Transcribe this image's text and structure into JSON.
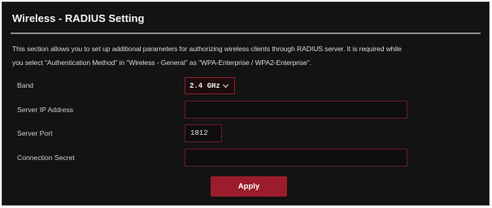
{
  "page": {
    "title": "Wireless - RADIUS Setting",
    "description_line1": "This section allows you to set up additional parameters for authorizing wireless clients through RADIUS server. It is required while",
    "description_line2": "you select \"Authentication Method\" in \"Wireless - General\" as \"WPA-Enterprise / WPA2-Enterprise\"."
  },
  "form": {
    "band": {
      "label": "Band",
      "value": "2.4 GHz"
    },
    "server_ip": {
      "label": "Server IP Address",
      "value": ""
    },
    "server_port": {
      "label": "Server Port",
      "value": "1812"
    },
    "connection_secret": {
      "label": "Connection Secret",
      "value": ""
    }
  },
  "actions": {
    "apply_label": "Apply"
  },
  "colors": {
    "accent": "#9b1d2b",
    "field_border": "#6b1d24",
    "background": "#131313"
  },
  "icons": {
    "band_dropdown": "chevron-down-icon"
  }
}
